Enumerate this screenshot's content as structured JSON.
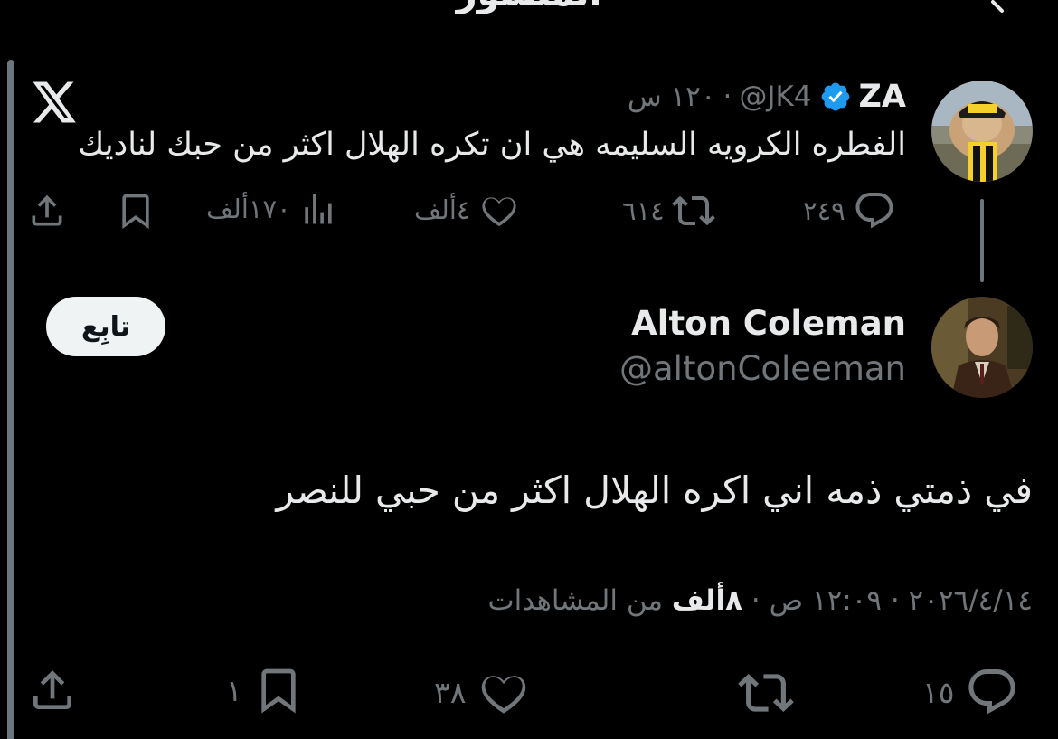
{
  "header": {
    "title": "المنشور"
  },
  "quoted_tweet": {
    "author_name": "ZA",
    "handle": "@JK4",
    "separator": "·",
    "time": "١٢٠ س",
    "text": "الفطره الكرويه السليمه هي ان تكره الهلال اكثر من حبك لناديك",
    "replies": "٢٤٩",
    "reposts": "٦١٤",
    "likes": "٤ألف",
    "views": "١٧٠ألف"
  },
  "main_tweet": {
    "author_name": "Alton Coleman",
    "handle": "@altonColeeman",
    "follow_label": "تابِع",
    "text": "في ذمتي ذمه اني اكره الهلال اكثر من حبي للنصر",
    "date": "٢٠٢٦/٤/١٤",
    "time": "١٢:٠٩ ص",
    "separator": "·",
    "views_count": "٨ألف",
    "views_label": "من المشاهدات",
    "replies": "١٥",
    "likes": "٣٨",
    "bookmarks": "١"
  },
  "colors": {
    "background": "#000000",
    "text_primary": "#e7e9ea",
    "text_secondary": "#71767b",
    "verified_blue": "#1d9bf0",
    "follow_bg": "#eff3f4"
  }
}
